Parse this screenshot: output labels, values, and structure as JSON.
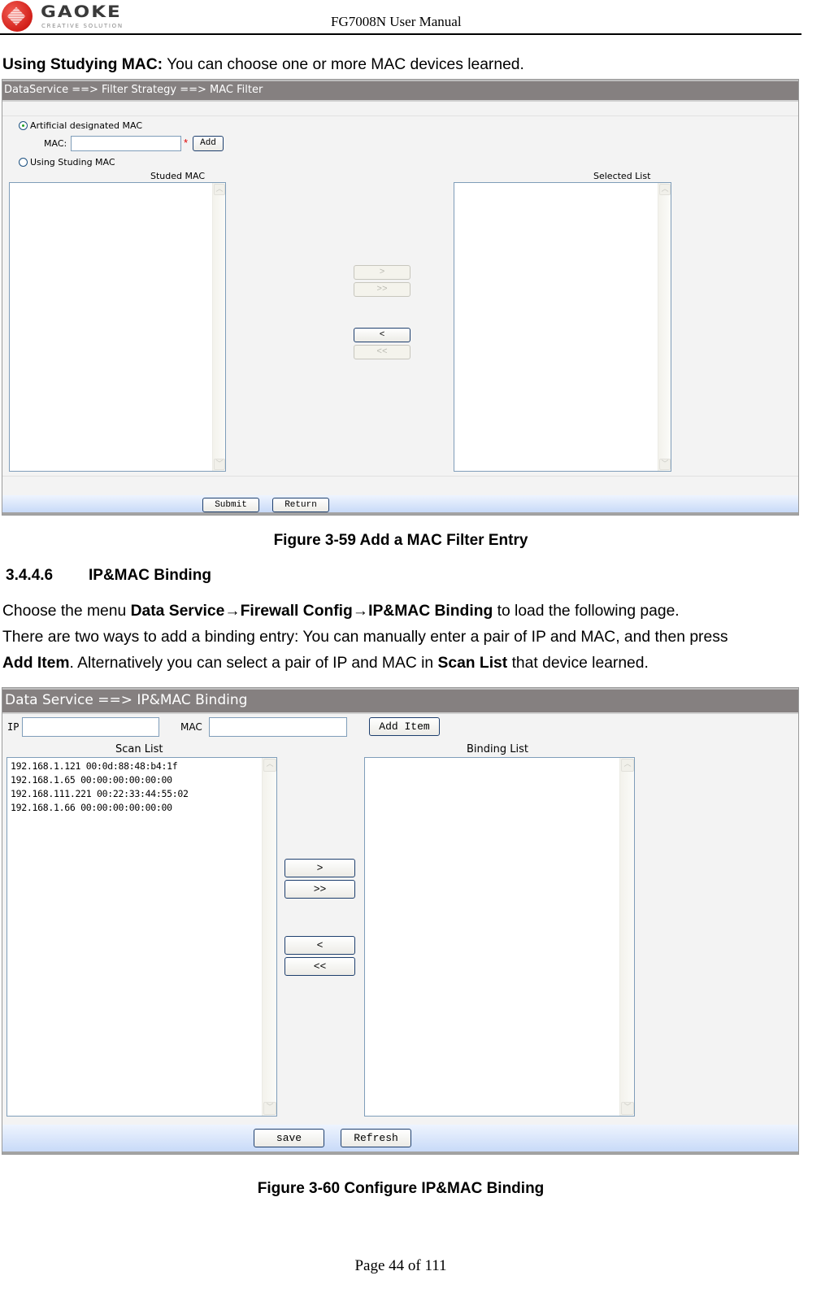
{
  "header": {
    "logo_word": "GAOKE",
    "logo_tagline": "CREATIVE SOLUTION",
    "doc_title": "FG7008N User Manual"
  },
  "intro": {
    "bold": "Using Studying MAC:",
    "text": " You can choose one or more MAC devices learned."
  },
  "figure1": {
    "breadcrumb": "DataService ==> Filter Strategy ==> MAC Filter",
    "radio_manual_label": "Artificial designated MAC",
    "radio_manual_checked": true,
    "mac_label": "MAC:",
    "mac_value": "",
    "required_mark": "*",
    "add_button": "Add",
    "radio_study_label": "Using Studing MAC",
    "radio_study_checked": false,
    "studied_list_title": "Studed MAC",
    "studied_list_items": [],
    "selected_list_title": "Selected List",
    "selected_list_items": [],
    "move_right": ">",
    "move_all_right": ">>",
    "move_left": "<",
    "move_all_left": "<<",
    "submit_button": "Submit",
    "return_button": "Return",
    "caption": "Figure 3-59   Add a MAC Filter Entry"
  },
  "section": {
    "number": "3.4.4.6",
    "title": "IP&MAC Binding"
  },
  "body": {
    "line1_pre": "Choose the menu ",
    "line1_bold": "Data Service→Firewall Config→IP&MAC Binding",
    "line1_post": " to load the following page.",
    "line2": "There are two ways to add a binding entry: You can manually enter a pair of IP and MAC, and then press",
    "line3_bold1": "Add Item",
    "line3_mid": ". Alternatively you can select a pair of IP and MAC in ",
    "line3_bold2": "Scan List",
    "line3_post": " that device learned."
  },
  "figure2": {
    "breadcrumb": "Data Service ==> IP&MAC Binding",
    "ip_label": "IP",
    "ip_value": "",
    "mac_label": "MAC",
    "mac_value": "",
    "add_item_button": "Add Item",
    "scan_list_title": "Scan List",
    "scan_list_items": [
      "192.168.1.121  00:0d:88:48:b4:1f",
      "192.168.1.65  00:00:00:00:00:00",
      "192.168.111.221  00:22:33:44:55:02",
      "192.168.1.66  00:00:00:00:00:00"
    ],
    "binding_list_title": "Binding List",
    "binding_list_items": [],
    "move_right": ">",
    "move_all_right": ">>",
    "move_left": "<",
    "move_all_left": "<<",
    "save_button": "save",
    "refresh_button": "Refresh",
    "caption": "Figure 3-60   Configure IP&MAC Binding"
  },
  "footer": {
    "page_label": "Page 44 of 111"
  }
}
